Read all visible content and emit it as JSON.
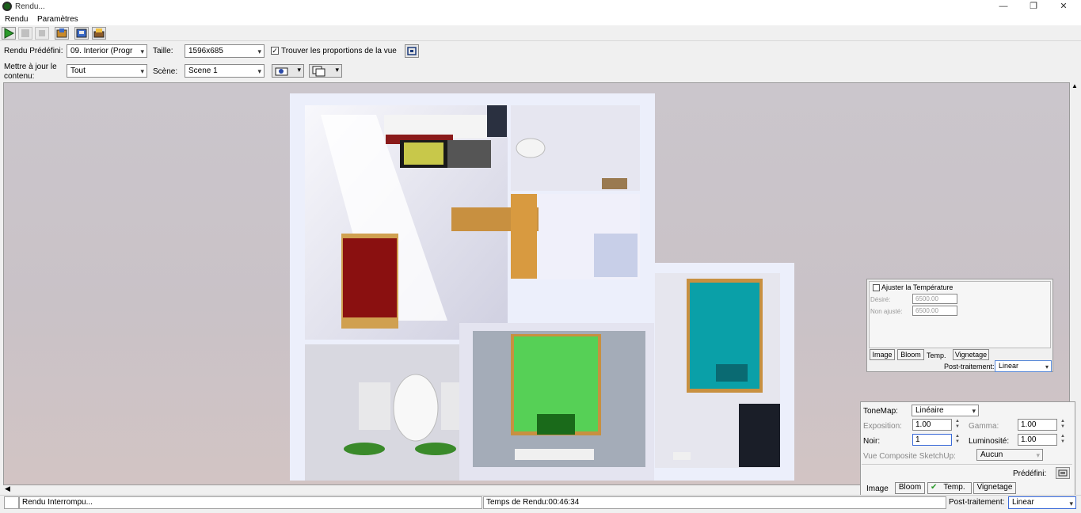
{
  "window": {
    "title": "Rendu...",
    "minimize": "—",
    "maximize": "❐",
    "close": "✕"
  },
  "menu": [
    "Rendu",
    "Paramètres"
  ],
  "toolbar1": {
    "preset_label": "Rendu Prédéfini:",
    "preset_value": "09. Interior (Progr",
    "size_label": "Taille:",
    "size_value": "1596x685",
    "proportions_label": "Trouver les proportions de la vue",
    "proportions_checked": true
  },
  "toolbar2": {
    "update_label_1": "Mettre à jour le",
    "update_label_2": "contenu:",
    "update_value": "Tout",
    "scene_label": "Scène:",
    "scene_value": "Scene 1"
  },
  "temp_panel": {
    "adjust_label": "Ajuster la Température",
    "desired_label": "Désiré:",
    "desired_value": "6500.00",
    "unadjusted_label": "Non ajusté:",
    "unadjusted_value": "6500.00",
    "tabs": [
      "Image",
      "Bloom",
      "Temp.",
      "Vignetage"
    ],
    "post_label": "Post-traitement:",
    "post_value": "Linear"
  },
  "tone_panel": {
    "tonemap_label": "ToneMap:",
    "tonemap_value": "Linéaire",
    "exposure_label": "Exposition:",
    "exposure_value": "1.00",
    "gamma_label": "Gamma:",
    "gamma_value": "1.00",
    "black_label": "Noir:",
    "black_value": "1",
    "luminosity_label": "Luminosité:",
    "luminosity_value": "1.00",
    "composite_label": "Vue Composite SketchUp:",
    "composite_value": "Aucun",
    "preset_label": "Prédéfini:",
    "tabs": [
      "Image",
      "Bloom",
      "Temp.",
      "Vignetage"
    ],
    "post_label": "Post-traitement:",
    "post_value": "Linear"
  },
  "status": {
    "state": "Rendu Interrompu...",
    "time": "Temps de Rendu:00:46:34"
  },
  "icons": [
    "play-icon",
    "pause-icon",
    "stop-icon",
    "export-icon",
    "save-icon",
    "print-icon",
    "fit-view-icon",
    "camera-icon",
    "window-icon"
  ]
}
